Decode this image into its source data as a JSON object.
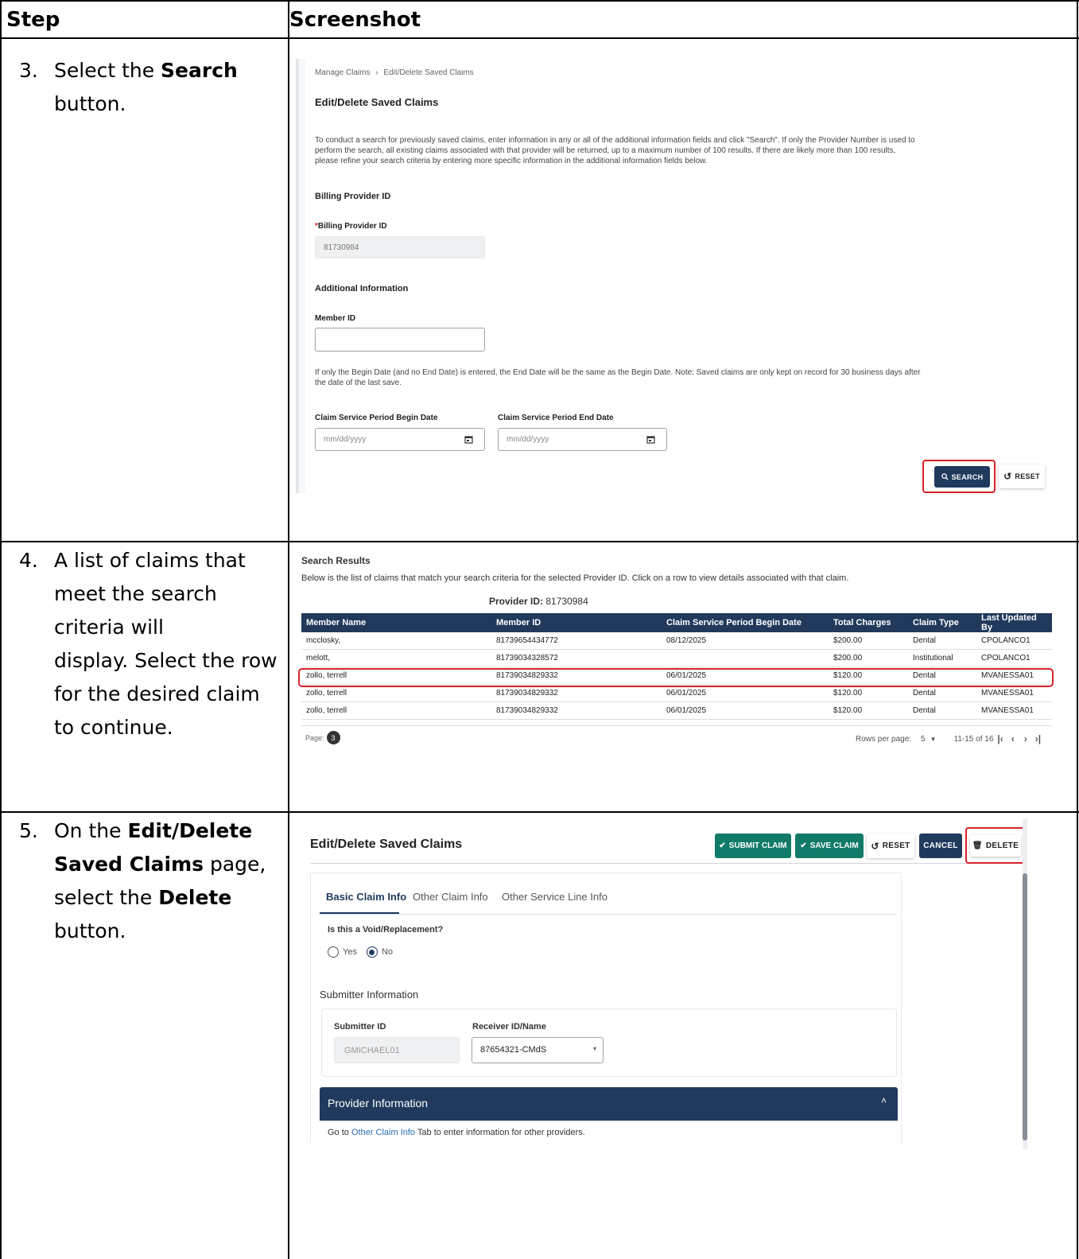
{
  "table_header": {
    "step": "Step",
    "screenshot": "Screenshot"
  },
  "steps": [
    {
      "num": "3.",
      "l1a": "Select the ",
      "l1b": "Search",
      "l2": "button."
    },
    {
      "num": "4.",
      "l1": "A list of claims that",
      "l2": "meet the search",
      "l3": "criteria will",
      "l4": "display. Select the row",
      "l5": "for the desired claim",
      "l6": "to continue."
    },
    {
      "num": "5.",
      "l1a": "On the ",
      "l1b": "Edit/Delete",
      "l2a": "Saved Claims",
      "l2b": " page,",
      "l3a": "select the ",
      "l3b": "Delete",
      "l4": "button."
    }
  ],
  "search_page": {
    "breadcrumb_1": "Manage Claims",
    "breadcrumb_sep": "›",
    "breadcrumb_2": "Edit/Delete Saved Claims",
    "title": "Edit/Delete Saved Claims",
    "intro_1": "To conduct a search for previously saved claims, enter information in any or all of the additional information fields and click \"Search\". If only the Provider Number is used to",
    "intro_2": "perform the search, all existing claims associated with that provider will be returned, up to a maximum number of 100 results. If there are likely more than 100 results,",
    "intro_3": "please refine your search criteria by entering more specific information in the additional information fields below.",
    "billing_section": "Billing Provider ID",
    "required_mark": "*",
    "billing_label": "Billing Provider ID",
    "billing_value": "81730984",
    "additional_section": "Additional Information",
    "member_label": "Member ID",
    "member_value": "",
    "date_note_1": "If only the Begin Date (and no End Date) is entered, the End Date will be the same as the Begin Date. Note: Saved claims are only kept on record for 30 business days after",
    "date_note_2": "the date of the last save.",
    "begin_label": "Claim Service Period Begin Date",
    "end_label": "Claim Service Period End Date",
    "date_placeholder": "mm/dd/yyyy",
    "search_label": "SEARCH",
    "reset_label": "RESET"
  },
  "results": {
    "heading": "Search Results",
    "description": "Below is the list of claims that match your search criteria for the selected Provider ID. Click on a row to view details associated with that claim.",
    "provider_label": "Provider ID:",
    "provider_value": "81730984",
    "columns": [
      "Member Name",
      "Member ID",
      "Claim Service Period Begin Date",
      "Total Charges",
      "Claim Type",
      "Last Updated By"
    ],
    "rows": [
      [
        "mcclosky,",
        "81739654434772",
        "08/12/2025",
        "$200.00",
        "Dental",
        "CPOLANCO1"
      ],
      [
        "melott,",
        "81739034328572",
        "",
        "$200.00",
        "Institutional",
        "CPOLANCO1"
      ],
      [
        "zollo, terrell",
        "81739034829332",
        "06/01/2025",
        "$120.00",
        "Dental",
        "MVANESSA01"
      ],
      [
        "zollo, terrell",
        "81739034829332",
        "06/01/2025",
        "$120.00",
        "Dental",
        "MVANESSA01"
      ],
      [
        "zollo, terrell",
        "81739034829332",
        "06/01/2025",
        "$120.00",
        "Dental",
        "MVANESSA01"
      ]
    ],
    "page_label": "Page:",
    "page_value": "3",
    "rows_per_page_label": "Rows per page:",
    "rows_per_page_value": "5",
    "range": "11-15 of 16"
  },
  "claim_page": {
    "title": "Edit/Delete Saved Claims",
    "submit_label": "SUBMIT CLAIM",
    "save_label": "SAVE CLAIM",
    "reset_label": "RESET",
    "cancel_label": "CANCEL",
    "delete_label": "DELETE",
    "tabs": [
      "Basic Claim Info",
      "Other Claim Info",
      "Other Service Line Info"
    ],
    "void_question": "Is this a Void/Replacement?",
    "yes_label": "Yes",
    "no_label": "No",
    "submitter_section": "Submitter Information",
    "submitter_id_label": "Submitter ID",
    "submitter_id_value": "GMICHAEL01",
    "receiver_label": "Receiver ID/Name",
    "receiver_value": "87654321-CMdS",
    "provider_section": "Provider Information",
    "goto_1": "Go to ",
    "goto_link": "Other Claim Info",
    "goto_2": " Tab to enter information for other providers."
  },
  "colors": {
    "navy": "#203a5e",
    "green": "#117a68",
    "highlight_red": "#d8232a"
  }
}
